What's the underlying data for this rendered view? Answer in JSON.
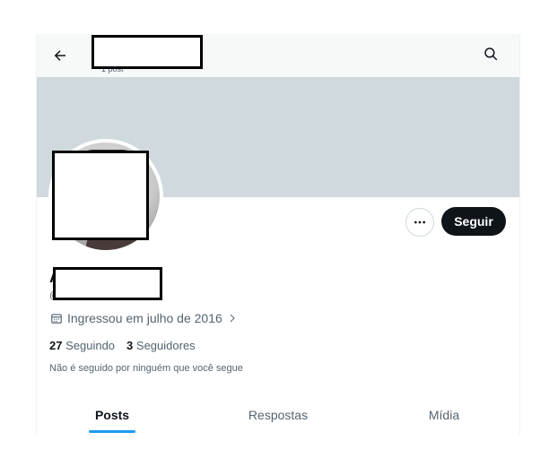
{
  "header": {
    "posts_count": "1 post",
    "back_icon": "arrow-left-icon",
    "search_icon": "search-icon"
  },
  "profile": {
    "name_initial": "A",
    "handle_initial": "@",
    "joined": "Ingressou em julho de 2016",
    "following_count": "27",
    "following_label": "Seguindo",
    "followers_count": "3",
    "followers_label": "Seguidores",
    "followed_by_note": "Não é seguido por ninguém que você segue"
  },
  "actions": {
    "more_icon": "more-horizontal-icon",
    "follow_label": "Seguir"
  },
  "tabs": [
    {
      "label": "Posts",
      "active": true
    },
    {
      "label": "Respostas",
      "active": false
    },
    {
      "label": "Mídia",
      "active": false
    }
  ],
  "colors": {
    "banner": "#cfd9de",
    "accent": "#1d9bf0",
    "follow_button": "#0f1419",
    "secondary_text": "#536471"
  }
}
